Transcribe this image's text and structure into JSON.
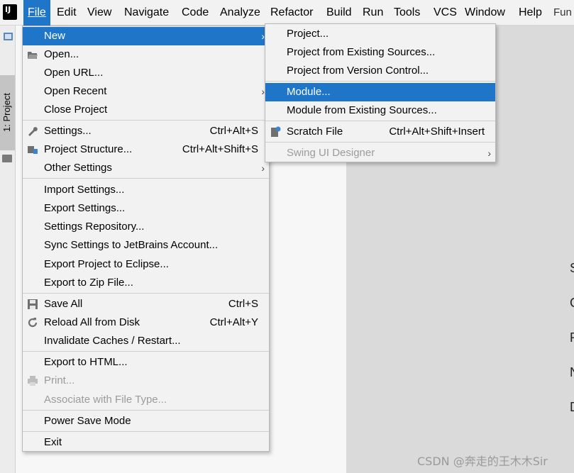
{
  "menubar": {
    "items": [
      "File",
      "Edit",
      "View",
      "Navigate",
      "Code",
      "Analyze",
      "Refactor",
      "Build",
      "Run",
      "Tools",
      "VCS",
      "Window",
      "Help"
    ],
    "truncated": "Fun"
  },
  "toolstrip": {
    "project_tab": "1: Project"
  },
  "editor": {
    "right_letters": [
      "S",
      "G",
      "R",
      "N",
      "D"
    ]
  },
  "watermark": "CSDN @奔走的王木木Sir",
  "file_menu": {
    "new": "New",
    "open": "Open...",
    "open_url": "Open URL...",
    "open_recent": "Open Recent",
    "close_project": "Close Project",
    "settings": "Settings...",
    "settings_sc": "Ctrl+Alt+S",
    "project_structure": "Project Structure...",
    "project_structure_sc": "Ctrl+Alt+Shift+S",
    "other_settings": "Other Settings",
    "import_settings": "Import Settings...",
    "export_settings": "Export Settings...",
    "settings_repository": "Settings Repository...",
    "sync_settings": "Sync Settings to JetBrains Account...",
    "export_eclipse": "Export Project to Eclipse...",
    "export_zip": "Export to Zip File...",
    "save_all": "Save All",
    "save_all_sc": "Ctrl+S",
    "reload_all": "Reload All from Disk",
    "reload_all_sc": "Ctrl+Alt+Y",
    "invalidate_caches": "Invalidate Caches / Restart...",
    "export_html": "Export to HTML...",
    "print": "Print...",
    "associate": "Associate with File Type...",
    "power_save": "Power Save Mode",
    "exit": "Exit"
  },
  "new_submenu": {
    "project": "Project...",
    "project_existing": "Project from Existing Sources...",
    "project_vcs": "Project from Version Control...",
    "module": "Module...",
    "module_existing": "Module from Existing Sources...",
    "scratch_file": "Scratch File",
    "scratch_file_sc": "Ctrl+Alt+Shift+Insert",
    "swing_designer": "Swing UI Designer"
  },
  "colors": {
    "accent": "#1f76c9",
    "menu_bg": "#f2f2f2",
    "disabled": "#9b9b9b"
  }
}
